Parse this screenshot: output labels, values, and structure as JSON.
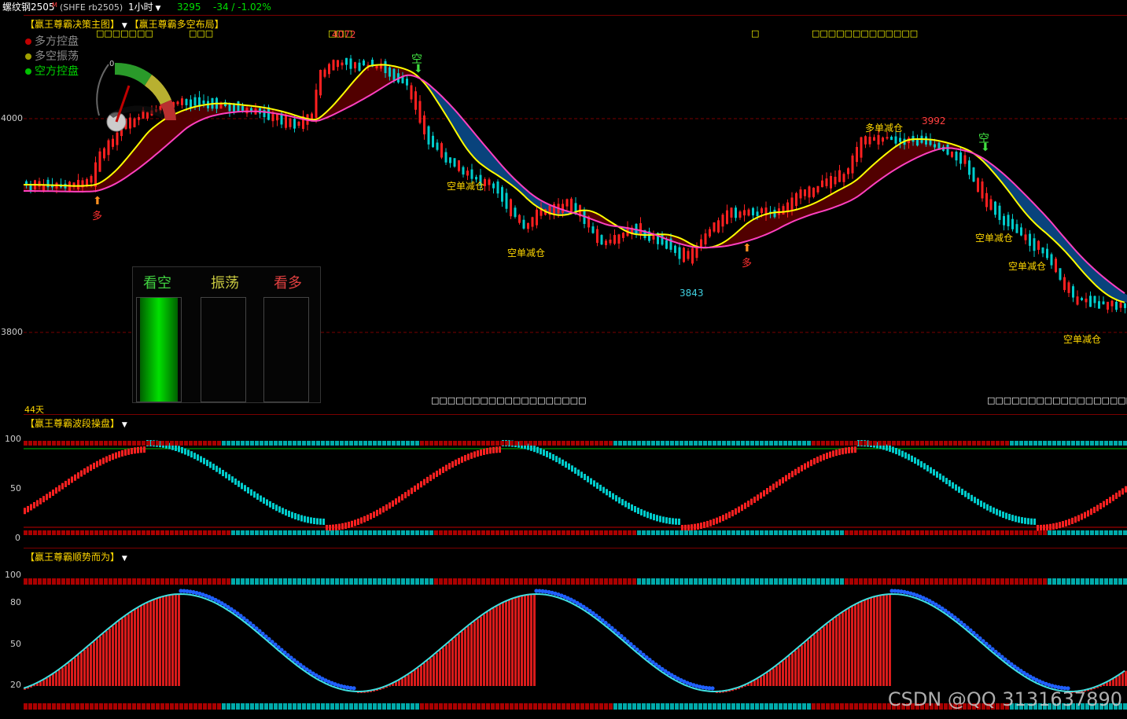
{
  "header": {
    "symbol": "螺纹钢2505",
    "symbol_sup": "M",
    "exchange": "(SHFE rb2505)",
    "period": "1小时",
    "last_price": "3295",
    "change": "-34 / -1.02%"
  },
  "main_panel": {
    "title_1": "【赢王尊霸决策主图】",
    "title_2": "【赢王尊霸多空布局】",
    "legend": [
      {
        "label": "多方控盘",
        "color": "#c00000"
      },
      {
        "label": "多空振荡",
        "color": "#a0a000"
      },
      {
        "label": "空方控盘",
        "color": "#00c000"
      }
    ],
    "y_ticks": [
      "4000",
      "3800"
    ],
    "gauge_zero": "0",
    "days_label": "44天",
    "annotations": {
      "peak_left": "4072",
      "peak_right": "3992",
      "trough": "3843",
      "short_reduce": "空单减仓",
      "long_reduce": "多单减仓",
      "kong": "空",
      "duo": "多"
    },
    "placeholders": [
      "□□□□□□□",
      "□□□",
      "□□□",
      "□",
      "□□□□□□□□□□□□□",
      "□□□□□□□□□□□□□□□□□□□",
      "□□□□□□□□□□□□□□□□□□□□"
    ],
    "stat_box": {
      "bear": "看空",
      "range": "振荡",
      "bull": "看多",
      "bear_fill": 1.0,
      "range_fill": 0,
      "bull_fill": 0
    }
  },
  "wave_panel": {
    "title": "【赢王尊霸波段操盘】",
    "y_ticks": [
      "100",
      "50",
      "0"
    ]
  },
  "trend_panel": {
    "title": "【赢王尊霸顺势而为】",
    "y_ticks": [
      "100",
      "80",
      "50",
      "20"
    ]
  },
  "watermark": "CSDN @QQ 3131637890",
  "colors": {
    "up": "#ff2020",
    "down": "#00cccc",
    "ma_yellow": "#ffff00",
    "ma_pink": "#ff40c0",
    "cloud_blue": "#0a4a8a",
    "cloud_red": "#5a0000"
  }
}
